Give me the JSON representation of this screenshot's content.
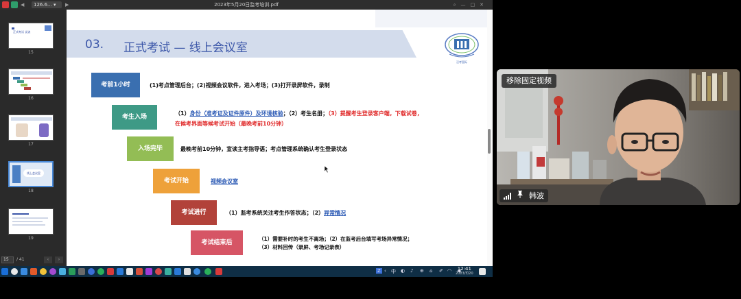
{
  "window": {
    "title": "2023年5月20日监考培训.pdf",
    "zoom": "126.6...",
    "back_icon": "arrow-left-icon",
    "forward_icon": "arrow-right-icon"
  },
  "sidebar": {
    "thumbnails": [
      {
        "page": "15",
        "label": "正式考试 议流",
        "active": false
      },
      {
        "page": "16",
        "active": false
      },
      {
        "page": "17",
        "active": false
      },
      {
        "page": "18",
        "label": "线上会议室",
        "active": true
      },
      {
        "page": "19",
        "active": false
      }
    ],
    "pager": {
      "current": "15",
      "total": "/ 41"
    }
  },
  "slide": {
    "section_number": "03.",
    "section_title": "正式考试 — 线上会议室",
    "logo_caption": "汉考国际",
    "steps": [
      {
        "label": "考前1小时",
        "color": "#3a6fb0",
        "desc": [
          {
            "t": "(1)考点管理后台；(2)视频会议软件，进入考场；(3)打开录屏软件，录制",
            "style": "normal"
          }
        ]
      },
      {
        "label": "考生入场",
        "color": "#3e9a86",
        "desc": [
          {
            "t": "（1）",
            "style": "normal"
          },
          {
            "t": "身份（准考证及证件原件）及环境核验",
            "style": "link"
          },
          {
            "t": "；（2）考生名册；",
            "style": "normal"
          },
          {
            "t": "（3）提醒考生登录客户端，下载试卷，",
            "style": "warn"
          }
        ],
        "desc2": [
          {
            "t": "在候考界面等候考试开始（最晚考前10分钟）",
            "style": "warn"
          }
        ]
      },
      {
        "label": "入场完毕",
        "color": "#93bd55",
        "desc": [
          {
            "t": "最晚考前10分钟，宣读主考指导语；考点管理系统确认考生登录状态",
            "style": "normal"
          }
        ]
      },
      {
        "label": "考试开始",
        "color": "#eea13a",
        "desc": [
          {
            "t": "视频会议室",
            "style": "link"
          }
        ]
      },
      {
        "label": "考试进行",
        "color": "#b2423a",
        "desc": [
          {
            "t": "（1）监考系统关注考生作答状态；（2）",
            "style": "normal"
          },
          {
            "t": "异常情况",
            "style": "link"
          }
        ]
      },
      {
        "label": "考试结束后",
        "color": "#d65565",
        "desc": [
          {
            "t": "（1）需要补时的考生不离场；（2）在监考后台填写考场异常情况；",
            "style": "normal"
          }
        ],
        "desc2": [
          {
            "t": "（3）材料回传（录屏、考场记录表）",
            "style": "normal"
          }
        ]
      }
    ]
  },
  "taskbar": {
    "time": "12:41",
    "date": "2023/5/20",
    "input_method": "Z",
    "lang": "中"
  },
  "video": {
    "unpin_label": "移除固定视频",
    "participant_name": "韩波",
    "signal_icon": "signal-bars-icon",
    "pin_icon": "pin-icon"
  }
}
